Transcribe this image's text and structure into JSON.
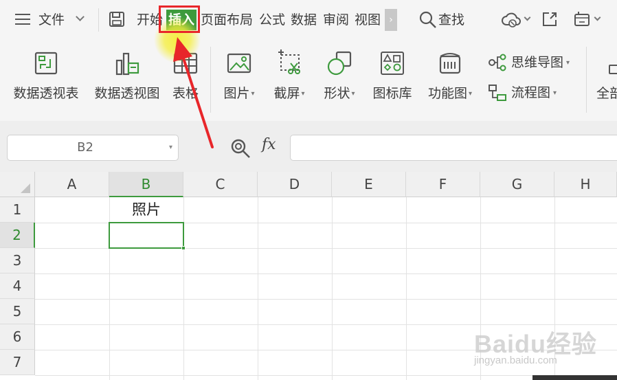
{
  "menubar": {
    "file_label": "文件",
    "tabs": [
      {
        "label": "开始"
      },
      {
        "label": "插入"
      },
      {
        "label": "页面布局"
      },
      {
        "label": "公式"
      },
      {
        "label": "数据"
      },
      {
        "label": "审阅"
      },
      {
        "label": "视图"
      }
    ],
    "search_label": "查找"
  },
  "ribbon": {
    "pivot_table": "数据透视表",
    "pivot_chart": "数据透视图",
    "table": "表格",
    "picture": "图片",
    "screenshot": "截屏",
    "shapes": "形状",
    "icon_library": "图标库",
    "function_chart": "功能图",
    "mind_map": "思维导图",
    "flowchart": "流程图",
    "cut_off_label": "全部"
  },
  "formula_bar": {
    "cell_reference": "B2",
    "fx_label": "fx",
    "formula_value": ""
  },
  "grid": {
    "columns": [
      "A",
      "B",
      "C",
      "D",
      "E",
      "F",
      "G",
      "H"
    ],
    "rows": [
      "1",
      "2",
      "3",
      "4",
      "5",
      "6",
      "7"
    ],
    "cells": {
      "B1": "照片"
    },
    "selected_cell": "B2"
  },
  "watermark": {
    "brand": "Baidu经验",
    "url": "jingyan.baidu.com"
  },
  "colors": {
    "accent_green": "#3d9a3d",
    "annotation_red": "#e8262a",
    "highlight_yellow": "#f5ee3a"
  }
}
